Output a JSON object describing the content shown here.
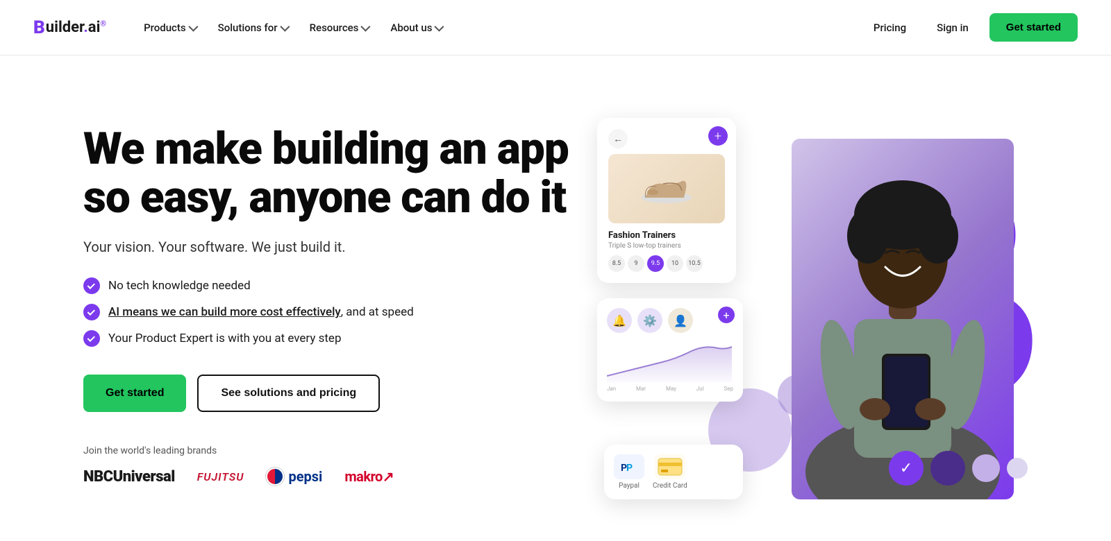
{
  "logo": {
    "b": "B",
    "name": "uilder",
    "dot": ".",
    "ai": "ai",
    "reg": "®"
  },
  "nav": {
    "products_label": "Products",
    "solutions_label": "Solutions for",
    "resources_label": "Resources",
    "about_label": "About us",
    "pricing_label": "Pricing",
    "signin_label": "Sign in",
    "get_started_label": "Get started"
  },
  "hero": {
    "title_line1": "We make building an app",
    "title_line2": "so easy, anyone can do it",
    "subtitle": "Your vision. Your software. We just build it.",
    "feature1": "No tech knowledge needed",
    "feature2_link": "AI means we can build more cost effectively",
    "feature2_rest": ", and at speed",
    "feature3": "Your Product Expert is with you at every step",
    "btn_get_started": "Get started",
    "btn_solutions": "See solutions and pricing",
    "brands_label": "Join the world's leading brands",
    "brand1": "NBCUniversal",
    "brand2": "FUJITSU",
    "brand3": "pepsi",
    "brand4": "makro↗"
  },
  "app_card": {
    "title": "Fashion Trainers",
    "subtitle": "Triple S low-top trainers",
    "sizes": [
      "8.5",
      "9",
      "9.5",
      "10",
      "10.5"
    ],
    "active_size": "9.5"
  },
  "analytics_card": {
    "add_btn": "+"
  },
  "payment_card": {
    "paypal_label": "Paypal",
    "card_label": "Credit Card"
  },
  "decorations": {
    "check": "✓"
  }
}
